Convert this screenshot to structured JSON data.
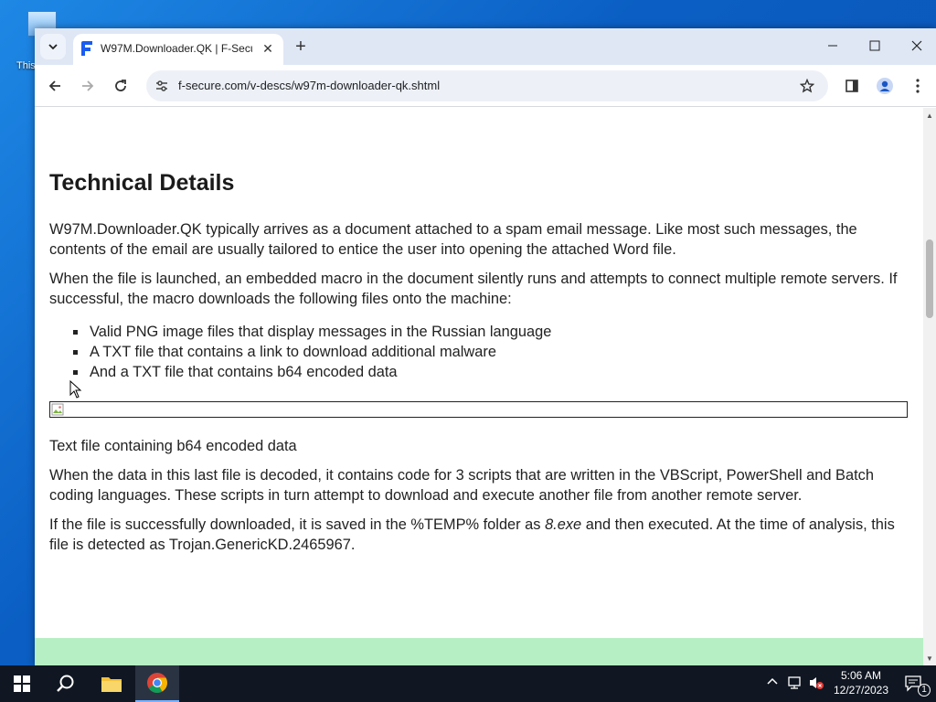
{
  "desktop": {
    "icon_label": "This"
  },
  "browser": {
    "tab_title": "W97M.Downloader.QK | F-Secu",
    "url": "f-secure.com/v-descs/w97m-downloader-qk.shtml"
  },
  "article": {
    "heading": "Technical Details",
    "para1": "W97M.Downloader.QK typically arrives as a document attached to a spam email message. Like most such messages, the contents of the email are usually tailored to entice the user into opening the attached Word file.",
    "para2": "When the file is launched, an embedded macro in the document silently runs and attempts to connect multiple remote servers. If successful, the macro downloads the following files onto the machine:",
    "list": [
      "Valid PNG image files that display messages in the Russian language",
      "A TXT file that contains a link to download additional malware",
      "And a TXT file that contains b64 encoded data"
    ],
    "caption": "Text file containing b64 encoded data",
    "para3": "When the data in this last file is decoded, it contains code for 3 scripts that are written in the VBScript, PowerShell and Batch coding languages. These scripts in turn attempt to download and execute another file from another remote server.",
    "para4_pre": "If the file is successfully downloaded, it is saved in the %TEMP% folder as ",
    "para4_em": "8.exe",
    "para4_post": " and then executed. At the time of analysis, this file is detected as Trojan.GenericKD.2465967."
  },
  "taskbar": {
    "time": "5:06 AM",
    "date": "12/27/2023",
    "notification_count": "1"
  },
  "colors": {
    "accent_green": "#b6efc4",
    "taskbar": "#101722"
  }
}
